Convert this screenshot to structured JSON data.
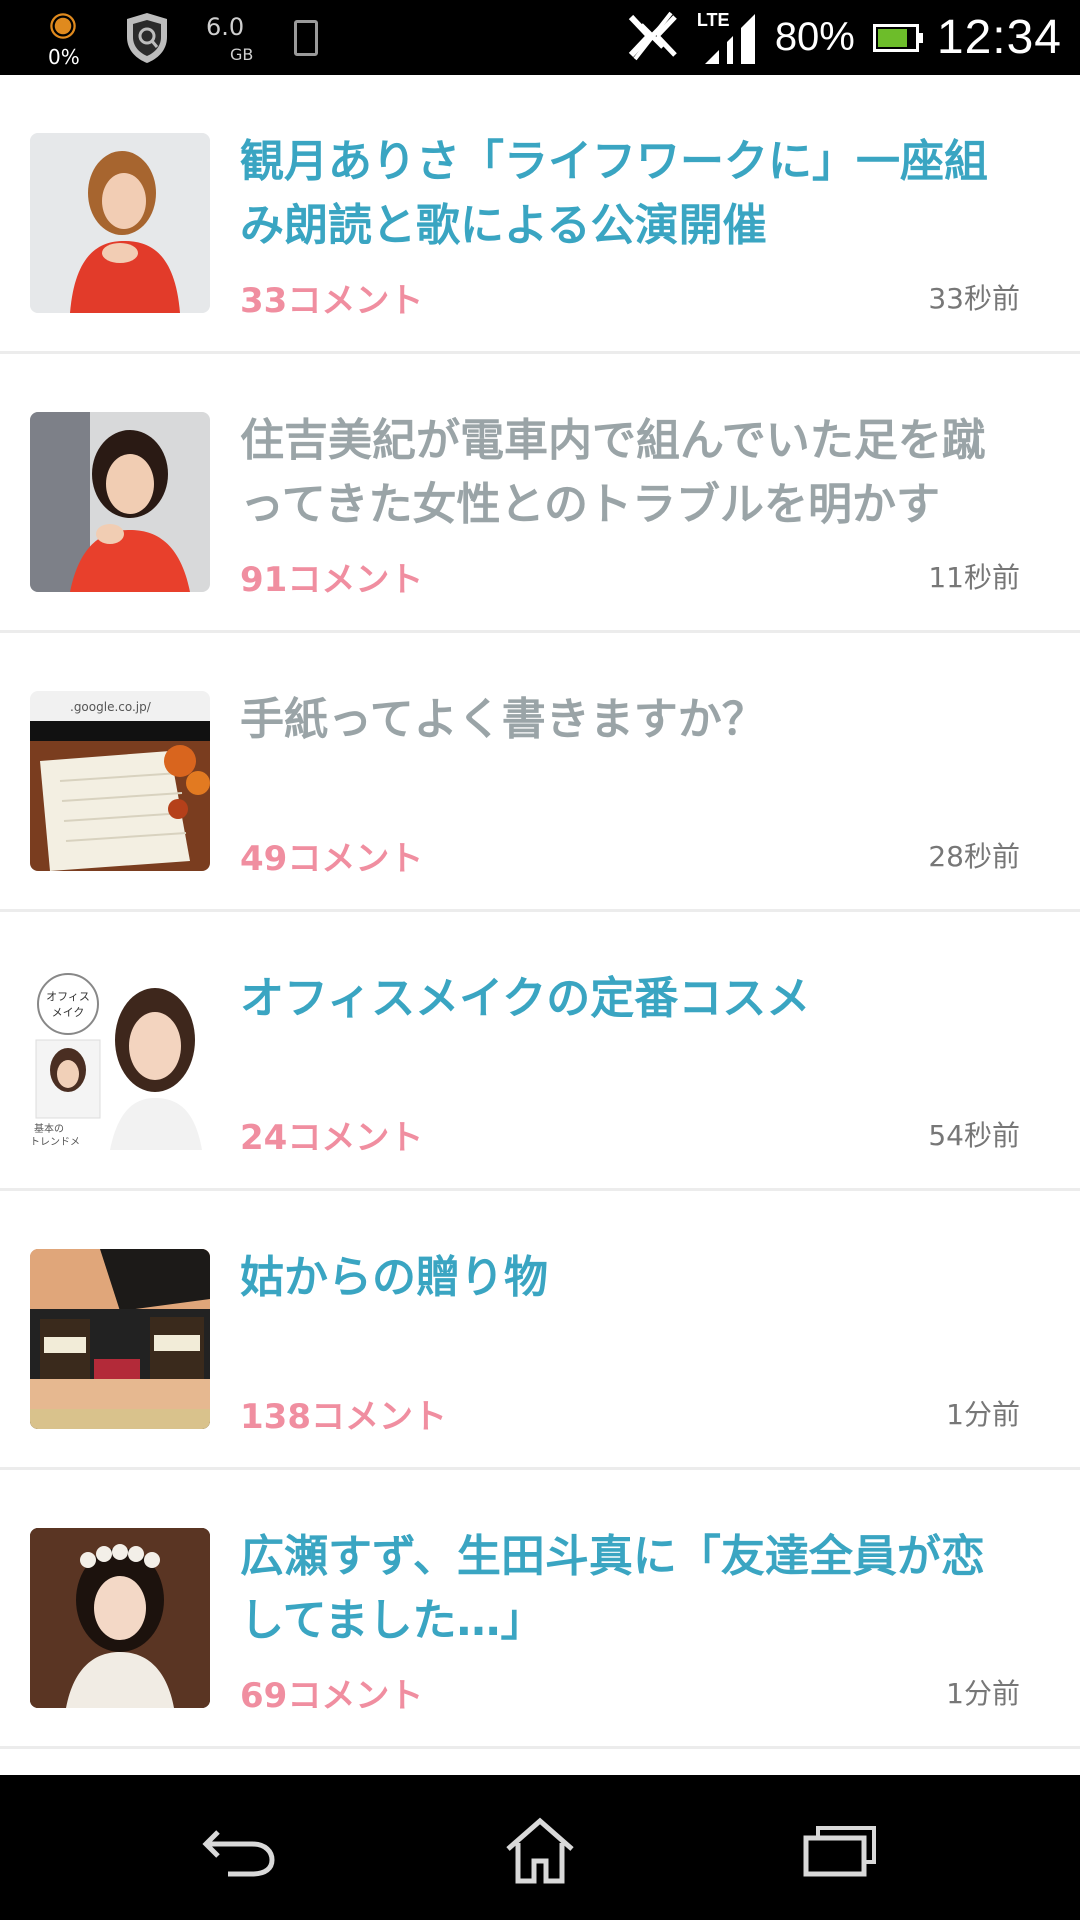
{
  "status_bar": {
    "cpu_percent": "0%",
    "storage_value": "6.0",
    "storage_unit": "GB",
    "network_type": "LTE",
    "battery_percent": "80%",
    "battery_level": 0.8,
    "clock": "12:34",
    "colors": {
      "background": "#000000",
      "cpu_icon": "#e08a1e",
      "battery_fill": "#6dbd2a"
    },
    "icons": [
      "cpu-gear-icon",
      "shield-icon",
      "phone-icon",
      "nfc-off-icon",
      "signal-icon",
      "battery-icon"
    ]
  },
  "feed": {
    "colors": {
      "title_unread": "#3aa5c2",
      "title_read": "#9aa4a7",
      "comment_count": "#f08ea0",
      "timestamp": "#777777"
    },
    "items": [
      {
        "title": "観月ありさ「ライフワークに」一座組み朗読と歌による公演開催",
        "comments": "33コメント",
        "time": "33秒前",
        "read": false,
        "thumb": "woman-red-dress-photo"
      },
      {
        "title": "住吉美紀が電車内で組んでいた足を蹴ってきた女性とのトラブルを明かす",
        "comments": "91コメント",
        "time": "11秒前",
        "read": true,
        "thumb": "woman-smiling-photo"
      },
      {
        "title": "手紙ってよく書きますか？",
        "comments": "49コメント",
        "time": "28秒前",
        "read": true,
        "thumb": "letter-paper-photo",
        "thumb_url_text": ".google.co.jp/"
      },
      {
        "title": "オフィスメイクの定番コスメ",
        "comments": "24コメント",
        "time": "54秒前",
        "read": false,
        "thumb": "office-makeup-photo",
        "thumb_badge_line1": "オフィス",
        "thumb_badge_line2": "メイク",
        "thumb_caption_line1": "基本の",
        "thumb_caption_line2": "トレンドメ"
      },
      {
        "title": "姑からの贈り物",
        "comments": "138コメント",
        "time": "1分前",
        "read": false,
        "thumb": "gift-box-photo"
      },
      {
        "title": "広瀬すず、生田斗真に「友達全員が恋してました…」",
        "comments": "69コメント",
        "time": "1分前",
        "read": false,
        "thumb": "girl-flower-crown-photo"
      }
    ]
  },
  "nav_bar": {
    "icons": [
      "back-icon",
      "home-icon",
      "recents-icon"
    ]
  }
}
